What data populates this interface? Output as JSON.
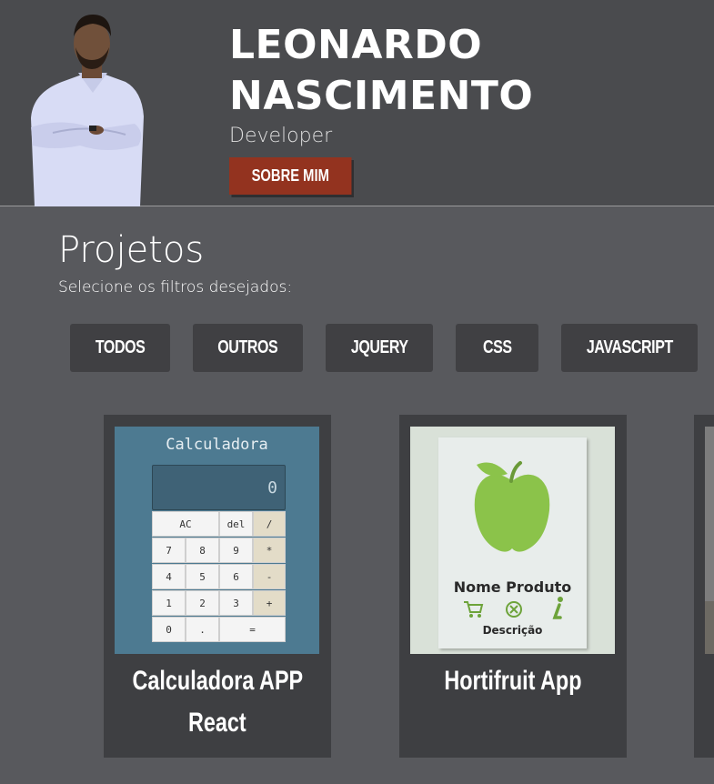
{
  "header": {
    "name_line1": "LEONARDO",
    "name_line2": "NASCIMENTO",
    "role": "Developer",
    "about_button": "SOBRE MIM"
  },
  "projects": {
    "title": "Projetos",
    "subtitle": "Selecione os filtros desejados:",
    "filters": [
      "TODOS",
      "OUTROS",
      "JQUERY",
      "CSS",
      "JAVASCRIPT"
    ],
    "cards": [
      {
        "title_line1": "Calculadora APP",
        "title_line2": "React",
        "thumbnail": {
          "heading": "Calculadora",
          "display": "0",
          "keys": [
            "AC",
            "del",
            "/",
            "7",
            "8",
            "9",
            "*",
            "4",
            "5",
            "6",
            "-",
            "1",
            "2",
            "3",
            "+",
            "0",
            ".",
            "="
          ]
        }
      },
      {
        "title_line1": "Hortifruit App",
        "thumbnail": {
          "product_name": "Nome Produto",
          "description": "Descrição",
          "icons": [
            "cart-icon",
            "remove-icon",
            "info-icon"
          ]
        }
      }
    ]
  },
  "colors": {
    "page_bg": "#58595d",
    "header_bg": "#4a4b4e",
    "card_bg": "#3e3f42",
    "accent": "#93331f",
    "apple_green": "#8bc34a"
  }
}
